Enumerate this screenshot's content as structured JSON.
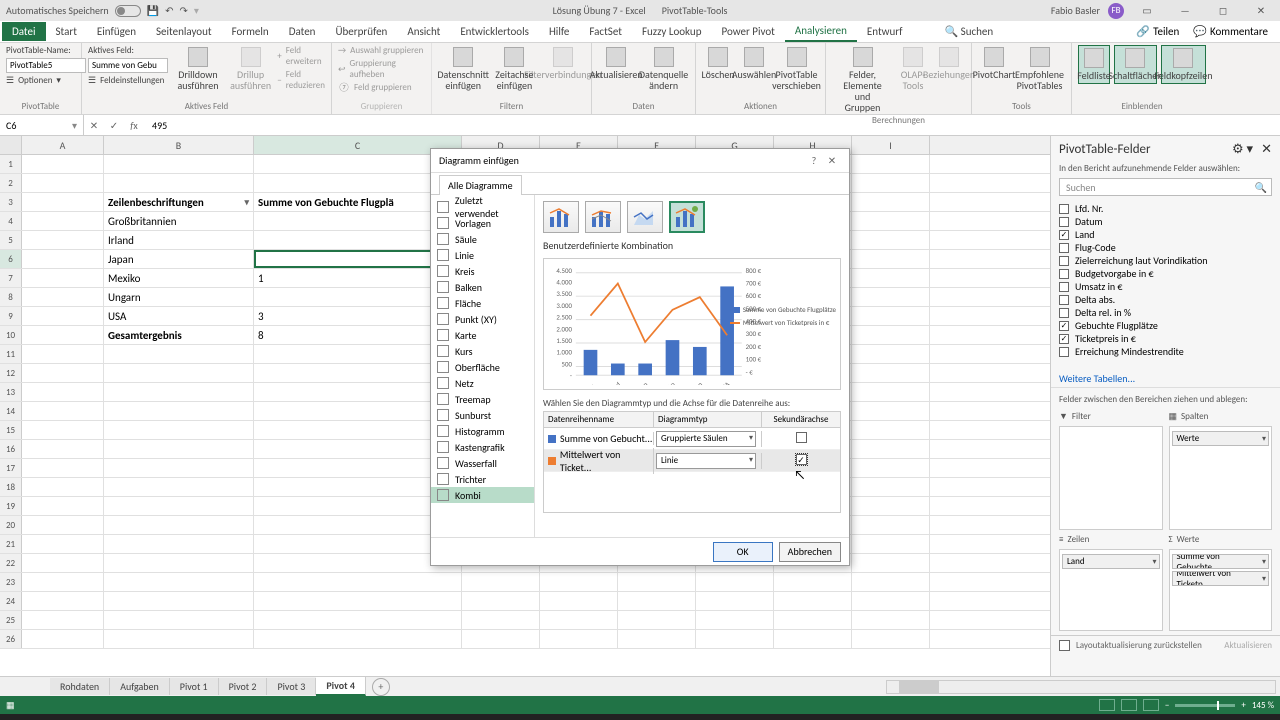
{
  "titlebar": {
    "autosave": "Automatisches Speichern",
    "doc": "Lösung Übung 7 - Excel",
    "context": "PivotTable-Tools",
    "user": "Fabio Basler",
    "avatar": "FB"
  },
  "ribbon_tabs": {
    "file": "Datei",
    "tabs": [
      "Start",
      "Einfügen",
      "Seitenlayout",
      "Formeln",
      "Daten",
      "Überprüfen",
      "Ansicht",
      "Entwicklertools",
      "Hilfe",
      "FactSet",
      "Fuzzy Lookup",
      "Power Pivot",
      "Analysieren",
      "Entwurf",
      "Suchen"
    ],
    "active": "Analysieren",
    "share": "Teilen",
    "comments": "Kommentare"
  },
  "ribbon": {
    "pt_group": "PivotTable",
    "pt_name_lbl": "PivotTable-Name:",
    "pt_name": "PivotTable5",
    "pt_opts": "Optionen",
    "af_group": "Aktives Feld",
    "af_lbl": "Aktives Feld:",
    "af_val": "Summe von Gebu",
    "af_settings": "Feldeinstellungen",
    "drilldown": "Drilldown ausführen",
    "drillup": "Drillup ausführen",
    "fe_expand": "Feld erweitern",
    "fe_collapse": "Feld reduzieren",
    "grp_group": "Gruppieren",
    "grp_sel": "Auswahl gruppieren",
    "grp_un": "Gruppierung aufheben",
    "grp_field": "Feld gruppieren",
    "filter_group": "Filtern",
    "slicer": "Datenschnitt einfügen",
    "timeline": "Zeitachse einfügen",
    "filterconn": "Filterverbindungen",
    "data_group": "Daten",
    "refresh": "Aktualisieren",
    "changeds": "Datenquelle ändern",
    "actions_group": "Aktionen",
    "clear": "Löschen",
    "select": "Auswählen",
    "move": "PivotTable verschieben",
    "calc_group": "Berechnungen",
    "fields_items": "Felder, Elemente und Gruppen",
    "olap": "OLAP-Tools",
    "relations": "Beziehungen",
    "tools_group": "Tools",
    "pchart": "PivotChart",
    "recommend": "Empfohlene PivotTables",
    "show_group": "Einblenden",
    "fieldlist": "Feldliste",
    "buttons": "Schaltflächen",
    "headers": "Feldkopfzeilen"
  },
  "formula": {
    "cell": "C6",
    "value": "495"
  },
  "cols": [
    "A",
    "B",
    "C",
    "D",
    "E",
    "F",
    "G",
    "H",
    "I"
  ],
  "rows_data": [
    {
      "n": 1
    },
    {
      "n": 2
    },
    {
      "n": 3,
      "B": "Zeilenbeschriftungen",
      "C": "Summe von Gebuchte Flugplä"
    },
    {
      "n": 4,
      "B": "Großbritannien",
      "C": ""
    },
    {
      "n": 5,
      "B": "Irland",
      "C": ""
    },
    {
      "n": 6,
      "B": "Japan",
      "C": ""
    },
    {
      "n": 7,
      "B": "Mexiko",
      "C": "1"
    },
    {
      "n": 8,
      "B": "Ungarn",
      "C": ""
    },
    {
      "n": 9,
      "B": "USA",
      "C": "3"
    },
    {
      "n": 10,
      "B": "Gesamtergebnis",
      "C": "8"
    },
    {
      "n": 11
    },
    {
      "n": 12
    },
    {
      "n": 13
    },
    {
      "n": 14
    },
    {
      "n": 15
    },
    {
      "n": 16
    },
    {
      "n": 17
    },
    {
      "n": 18
    },
    {
      "n": 19
    },
    {
      "n": 20
    },
    {
      "n": 21
    },
    {
      "n": 22
    },
    {
      "n": 23
    },
    {
      "n": 24
    },
    {
      "n": 25
    },
    {
      "n": 26
    }
  ],
  "sheets": [
    "Rohdaten",
    "Aufgaben",
    "Pivot 1",
    "Pivot 2",
    "Pivot 3",
    "Pivot 4"
  ],
  "sheet_active": "Pivot 4",
  "dialog": {
    "title": "Diagramm einfügen",
    "tab": "Alle Diagramme",
    "cats": [
      "Zuletzt verwendet",
      "Vorlagen",
      "Säule",
      "Linie",
      "Kreis",
      "Balken",
      "Fläche",
      "Punkt (XY)",
      "Karte",
      "Kurs",
      "Oberfläche",
      "Netz",
      "Treemap",
      "Sunburst",
      "Histogramm",
      "Kastengrafik",
      "Wasserfall",
      "Trichter",
      "Kombi"
    ],
    "cat_sel": "Kombi",
    "subtitle": "Benutzerdefinierte Kombination",
    "series_instr": "Wählen Sie den Diagrammtyp und die Achse für die Datenreihe aus:",
    "col_name": "Datenreihenname",
    "col_type": "Diagrammtyp",
    "col_sec": "Sekundärachse",
    "series": [
      {
        "name": "Summe von Gebucht...",
        "type": "Gruppierte Säulen",
        "color": "#4472c4",
        "sec": false
      },
      {
        "name": "Mittelwert von Ticket...",
        "type": "Linie",
        "color": "#ed7d31",
        "sec": true
      }
    ],
    "ok": "OK",
    "cancel": "Abbrechen",
    "legend1": "Summe von Gebuchte Flugplätze",
    "legend2": "Mittelwert von Ticketpreis in €"
  },
  "chart_data": {
    "type": "combo",
    "categories": [
      "Großbritannien",
      "Irland",
      "Japan",
      "Mexiko",
      "Ungarn",
      "USA"
    ],
    "series": [
      {
        "name": "Summe von Gebuchte Flugplätze",
        "type": "bar",
        "axis": "primary",
        "color": "#4472c4",
        "values": [
          1100,
          500,
          500,
          1500,
          1200,
          3800
        ]
      },
      {
        "name": "Mittelwert von Ticketpreis in €",
        "type": "line",
        "axis": "secondary",
        "color": "#ed7d31",
        "values": [
          450,
          700,
          250,
          500,
          600,
          300
        ]
      }
    ],
    "y_primary": {
      "min": 0,
      "max": 4500,
      "step": 500,
      "ticks": [
        "-",
        "500",
        "1.000",
        "1.500",
        "2.000",
        "2.500",
        "3.000",
        "3.500",
        "4.000",
        "4.500"
      ]
    },
    "y_secondary": {
      "min": 0,
      "max": 800,
      "step": 100,
      "ticks": [
        "- €",
        "100 €",
        "200 €",
        "300 €",
        "400 €",
        "500 €",
        "600 €",
        "700 €",
        "800 €"
      ]
    }
  },
  "fieldpane": {
    "title": "PivotTable-Felder",
    "prompt": "In den Bericht aufzunehmende Felder auswählen:",
    "search": "Suchen",
    "fields": [
      {
        "n": "Lfd. Nr.",
        "c": false
      },
      {
        "n": "Datum",
        "c": false
      },
      {
        "n": "Land",
        "c": true
      },
      {
        "n": "Flug-Code",
        "c": false
      },
      {
        "n": "Zielerreichung laut Vorindikation",
        "c": false
      },
      {
        "n": "Budgetvorgabe in €",
        "c": false
      },
      {
        "n": "Umsatz in €",
        "c": false
      },
      {
        "n": "Delta abs.",
        "c": false
      },
      {
        "n": "Delta rel. in %",
        "c": false
      },
      {
        "n": "Gebuchte Flugplätze",
        "c": true
      },
      {
        "n": "Ticketpreis in €",
        "c": true
      },
      {
        "n": "Erreichung Mindestrendite",
        "c": false
      }
    ],
    "more": "Weitere Tabellen...",
    "areas_lbl": "Felder zwischen den Bereichen ziehen und ablegen:",
    "filter": "Filter",
    "columns": "Spalten",
    "rows": "Zeilen",
    "values": "Werte",
    "col_chip": "Werte",
    "row_chip": "Land",
    "val_chips": [
      "Summe von Gebuchte...",
      "Mittelwert von Ticketp..."
    ],
    "defer": "Layoutaktualisierung zurückstellen",
    "update": "Aktualisieren"
  },
  "status": {
    "zoom": "145 %"
  }
}
